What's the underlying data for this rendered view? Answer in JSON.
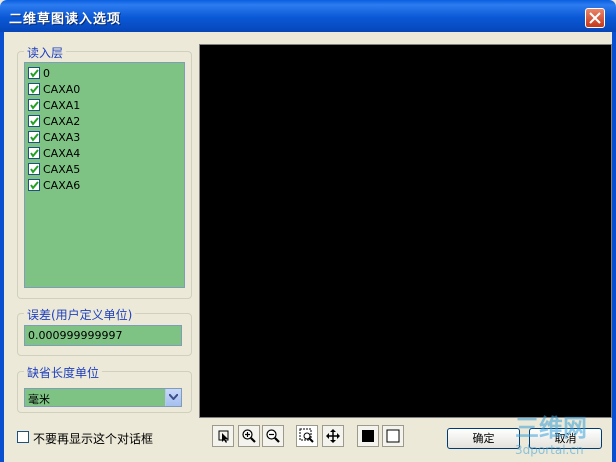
{
  "window": {
    "title": "二维草图读入选项"
  },
  "layers": {
    "group_label": "读入层",
    "items": [
      {
        "label": "0",
        "checked": true
      },
      {
        "label": "CAXA0",
        "checked": true
      },
      {
        "label": "CAXA1",
        "checked": true
      },
      {
        "label": "CAXA2",
        "checked": true
      },
      {
        "label": "CAXA3",
        "checked": true
      },
      {
        "label": "CAXA4",
        "checked": true
      },
      {
        "label": "CAXA5",
        "checked": true
      },
      {
        "label": "CAXA6",
        "checked": true
      }
    ]
  },
  "tolerance": {
    "group_label": "误差(用户定义单位)",
    "value": "0.000999999997"
  },
  "default_unit": {
    "group_label": "缺省长度单位",
    "selected": "毫米"
  },
  "footer": {
    "dont_show_label": "不要再显示这个对话框",
    "dont_show_checked": false,
    "ok_label": "确定",
    "cancel_label": "取消"
  },
  "watermark": {
    "line1": "三维网",
    "line2": "3dportal.cn"
  },
  "colors": {
    "list_bg": "#7ec384",
    "titlebar": "#0a58d6",
    "preview_bg": "#000000"
  }
}
